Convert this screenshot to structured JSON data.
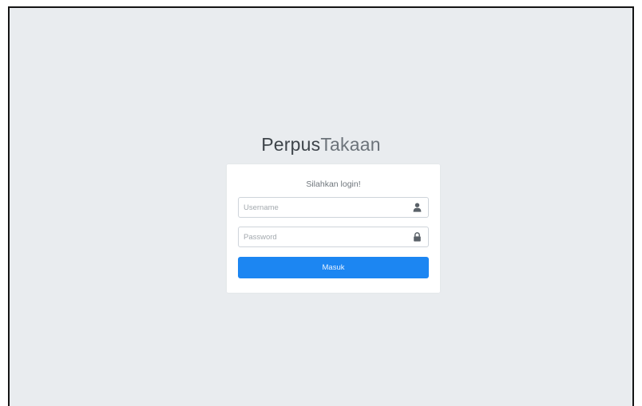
{
  "logo": {
    "part1": "Perpus",
    "part2": "Takaan"
  },
  "login": {
    "message": "Silahkan login!",
    "username": {
      "placeholder": "Username",
      "value": "",
      "icon": "user-icon"
    },
    "password": {
      "placeholder": "Password",
      "value": "",
      "icon": "lock-icon"
    },
    "submit_label": "Masuk"
  },
  "colors": {
    "page_background": "#e9ecef",
    "card_background": "#ffffff",
    "button": "#1c86f2",
    "icon": "#5a6168"
  }
}
